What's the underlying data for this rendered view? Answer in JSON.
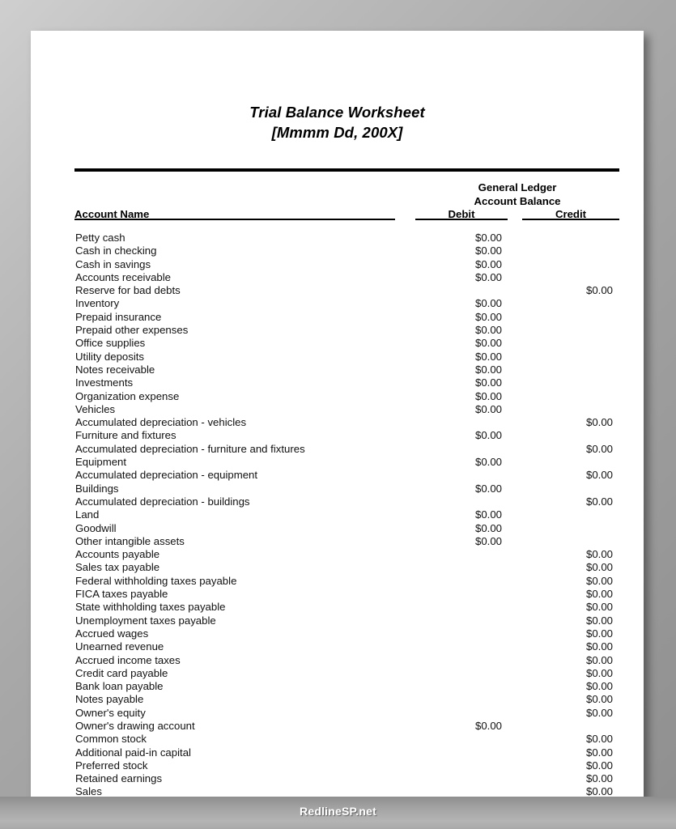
{
  "document": {
    "title": "Trial Balance Worksheet",
    "subtitle": "[Mmmm Dd, 200X]"
  },
  "table": {
    "group_header": {
      "line1": "General Ledger",
      "line2": "Account Balance"
    },
    "columns": {
      "account": "Account Name",
      "debit": "Debit",
      "credit": "Credit"
    },
    "rows": [
      {
        "account": "Petty cash",
        "debit": "$0.00",
        "credit": ""
      },
      {
        "account": "Cash in checking",
        "debit": "$0.00",
        "credit": ""
      },
      {
        "account": "Cash in savings",
        "debit": "$0.00",
        "credit": ""
      },
      {
        "account": "Accounts receivable",
        "debit": "$0.00",
        "credit": ""
      },
      {
        "account": "Reserve for bad debts",
        "debit": "",
        "credit": "$0.00"
      },
      {
        "account": "Inventory",
        "debit": "$0.00",
        "credit": ""
      },
      {
        "account": "Prepaid insurance",
        "debit": "$0.00",
        "credit": ""
      },
      {
        "account": "Prepaid other expenses",
        "debit": "$0.00",
        "credit": ""
      },
      {
        "account": "Office supplies",
        "debit": "$0.00",
        "credit": ""
      },
      {
        "account": "Utility deposits",
        "debit": "$0.00",
        "credit": ""
      },
      {
        "account": "Notes receivable",
        "debit": "$0.00",
        "credit": ""
      },
      {
        "account": "Investments",
        "debit": "$0.00",
        "credit": ""
      },
      {
        "account": "Organization expense",
        "debit": "$0.00",
        "credit": ""
      },
      {
        "account": "Vehicles",
        "debit": "$0.00",
        "credit": ""
      },
      {
        "account": "Accumulated depreciation - vehicles",
        "debit": "",
        "credit": "$0.00"
      },
      {
        "account": "Furniture and fixtures",
        "debit": "$0.00",
        "credit": ""
      },
      {
        "account": "Accumulated depreciation - furniture and fixtures",
        "debit": "",
        "credit": "$0.00"
      },
      {
        "account": "Equipment",
        "debit": "$0.00",
        "credit": ""
      },
      {
        "account": "Accumulated depreciation - equipment",
        "debit": "",
        "credit": "$0.00"
      },
      {
        "account": "Buildings",
        "debit": "$0.00",
        "credit": ""
      },
      {
        "account": "Accumulated depreciation - buildings",
        "debit": "",
        "credit": "$0.00"
      },
      {
        "account": "Land",
        "debit": "$0.00",
        "credit": ""
      },
      {
        "account": "Goodwill",
        "debit": "$0.00",
        "credit": ""
      },
      {
        "account": "Other intangible assets",
        "debit": "$0.00",
        "credit": ""
      },
      {
        "account": "Accounts payable",
        "debit": "",
        "credit": "$0.00"
      },
      {
        "account": "Sales tax payable",
        "debit": "",
        "credit": "$0.00"
      },
      {
        "account": "Federal withholding taxes payable",
        "debit": "",
        "credit": "$0.00"
      },
      {
        "account": "FICA taxes payable",
        "debit": "",
        "credit": "$0.00"
      },
      {
        "account": "State withholding taxes payable",
        "debit": "",
        "credit": "$0.00"
      },
      {
        "account": "Unemployment taxes payable",
        "debit": "",
        "credit": "$0.00"
      },
      {
        "account": "Accrued wages",
        "debit": "",
        "credit": "$0.00"
      },
      {
        "account": "Unearned revenue",
        "debit": "",
        "credit": "$0.00"
      },
      {
        "account": "Accrued income taxes",
        "debit": "",
        "credit": "$0.00"
      },
      {
        "account": "Credit card payable",
        "debit": "",
        "credit": "$0.00"
      },
      {
        "account": "Bank loan payable",
        "debit": "",
        "credit": "$0.00"
      },
      {
        "account": "Notes payable",
        "debit": "",
        "credit": "$0.00"
      },
      {
        "account": "Owner's equity",
        "debit": "",
        "credit": "$0.00"
      },
      {
        "account": "Owner's drawing account",
        "debit": "$0.00",
        "credit": ""
      },
      {
        "account": "Common stock",
        "debit": "",
        "credit": "$0.00"
      },
      {
        "account": "Additional paid-in capital",
        "debit": "",
        "credit": "$0.00"
      },
      {
        "account": "Preferred stock",
        "debit": "",
        "credit": "$0.00"
      },
      {
        "account": "Retained earnings",
        "debit": "",
        "credit": "$0.00"
      },
      {
        "account": "Sales",
        "debit": "",
        "credit": "$0.00"
      }
    ]
  },
  "footer": {
    "watermark": "RedlineSP.net"
  }
}
